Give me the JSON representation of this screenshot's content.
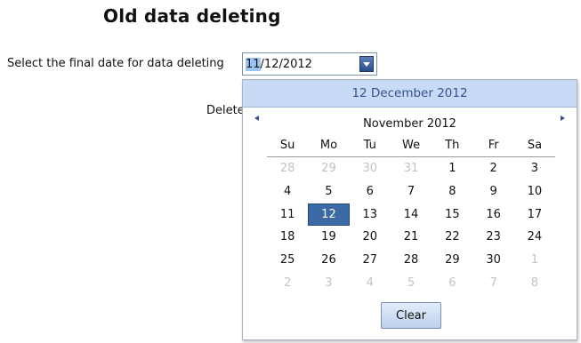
{
  "page": {
    "title": "Old data deleting",
    "date_label": "Select the final date for data deleting",
    "date_value_selected_part": "11",
    "date_value_rest": "/12/2012",
    "obscured_label": "Delete"
  },
  "calendar": {
    "today_text": "12 December 2012",
    "month_title": "November 2012",
    "days_of_week": [
      "Su",
      "Mo",
      "Tu",
      "We",
      "Th",
      "Fr",
      "Sa"
    ],
    "weeks": [
      [
        {
          "d": "28",
          "o": true
        },
        {
          "d": "29",
          "o": true
        },
        {
          "d": "30",
          "o": true
        },
        {
          "d": "31",
          "o": true
        },
        {
          "d": "1"
        },
        {
          "d": "2"
        },
        {
          "d": "3"
        }
      ],
      [
        {
          "d": "4"
        },
        {
          "d": "5"
        },
        {
          "d": "6"
        },
        {
          "d": "7"
        },
        {
          "d": "8"
        },
        {
          "d": "9"
        },
        {
          "d": "10"
        }
      ],
      [
        {
          "d": "11"
        },
        {
          "d": "12",
          "s": true
        },
        {
          "d": "13"
        },
        {
          "d": "14"
        },
        {
          "d": "15"
        },
        {
          "d": "16"
        },
        {
          "d": "17"
        }
      ],
      [
        {
          "d": "18"
        },
        {
          "d": "19"
        },
        {
          "d": "20"
        },
        {
          "d": "21"
        },
        {
          "d": "22"
        },
        {
          "d": "23"
        },
        {
          "d": "24"
        }
      ],
      [
        {
          "d": "25"
        },
        {
          "d": "26"
        },
        {
          "d": "27"
        },
        {
          "d": "28"
        },
        {
          "d": "29"
        },
        {
          "d": "30"
        },
        {
          "d": "1",
          "o": true
        }
      ],
      [
        {
          "d": "2",
          "o": true
        },
        {
          "d": "3",
          "o": true
        },
        {
          "d": "4",
          "o": true
        },
        {
          "d": "5",
          "o": true
        },
        {
          "d": "6",
          "o": true
        },
        {
          "d": "7",
          "o": true
        },
        {
          "d": "8",
          "o": true
        }
      ]
    ],
    "clear_label": "Clear",
    "icons": {
      "prev": "chevron-left-icon",
      "next": "chevron-right-icon",
      "dropdown": "chevron-down-icon"
    },
    "colors": {
      "today_bar": "#c7daf6",
      "selected_day": "#3b6aa6",
      "other_month_day": "#c3c3c3"
    }
  }
}
